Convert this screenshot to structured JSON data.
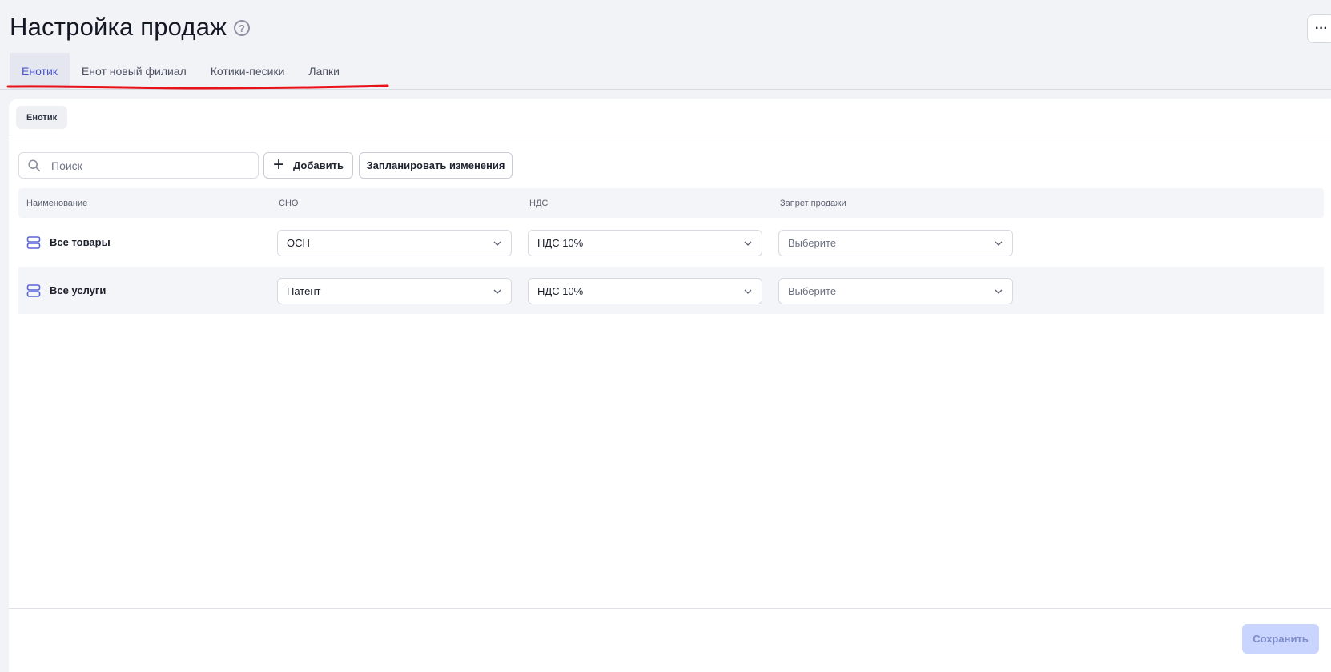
{
  "page": {
    "title": "Настройка продаж",
    "help_icon": "question-circle-icon",
    "more_icon": "ellipsis-icon",
    "more_label": "···"
  },
  "tabs": [
    {
      "label": "Енотик",
      "active": true
    },
    {
      "label": "Енот новый филиал",
      "active": false
    },
    {
      "label": "Котики-песики",
      "active": false
    },
    {
      "label": "Лапки",
      "active": false
    }
  ],
  "panel": {
    "chip": "Енотик",
    "search": {
      "placeholder": "Поиск",
      "value": ""
    },
    "add_button": "Добавить",
    "schedule_button": "Запланировать изменения",
    "columns": [
      "Наименование",
      "СНО",
      "НДС",
      "Запрет продажи"
    ],
    "rows": [
      {
        "name": "Все товары",
        "sno": "ОСН",
        "nds": "НДС 10%",
        "ban": "Выберите",
        "ban_placeholder": true
      },
      {
        "name": "Все услуги",
        "sno": "Патент",
        "nds": "НДС 10%",
        "ban": "Выберите",
        "ban_placeholder": true
      }
    ],
    "save_button": "Сохранить"
  },
  "colors": {
    "accent": "#4a56c7",
    "active_tab_bg": "#e4e6f0",
    "annotation_red": "#e8121a",
    "save_disabled_bg": "#c9d4ff",
    "row_icon": "#5a63d6"
  }
}
